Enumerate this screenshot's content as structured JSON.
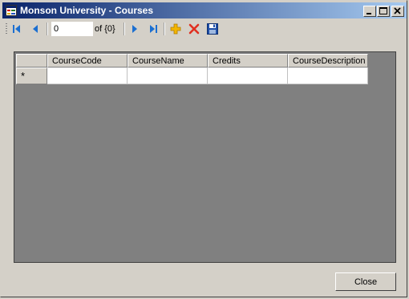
{
  "window": {
    "title": "Monson University - Courses",
    "icon": "form-icon",
    "controls": [
      "minimize-icon",
      "maximize-icon",
      "close-icon"
    ]
  },
  "toolbar": {
    "position_value": "0",
    "count_label": "of {0}",
    "buttons": [
      "move-first-icon",
      "move-previous-icon",
      "move-next-icon",
      "move-last-icon",
      "add-new-icon",
      "delete-icon",
      "save-icon"
    ]
  },
  "grid": {
    "columns": [
      "CourseCode",
      "CourseName",
      "Credits",
      "CourseDescription"
    ],
    "new_row_marker": "*",
    "rows": [
      [
        "",
        "",
        "",
        ""
      ]
    ]
  },
  "footer": {
    "close_label": "Close"
  },
  "colors": {
    "titlebar_start": "#0a246a",
    "titlebar_end": "#a6caf0",
    "grid_background": "#808080",
    "nav_icon": "#1b6fd1",
    "add_icon": "#f2b600",
    "delete_icon": "#e03020",
    "save_icon": "#1f4fa8"
  }
}
